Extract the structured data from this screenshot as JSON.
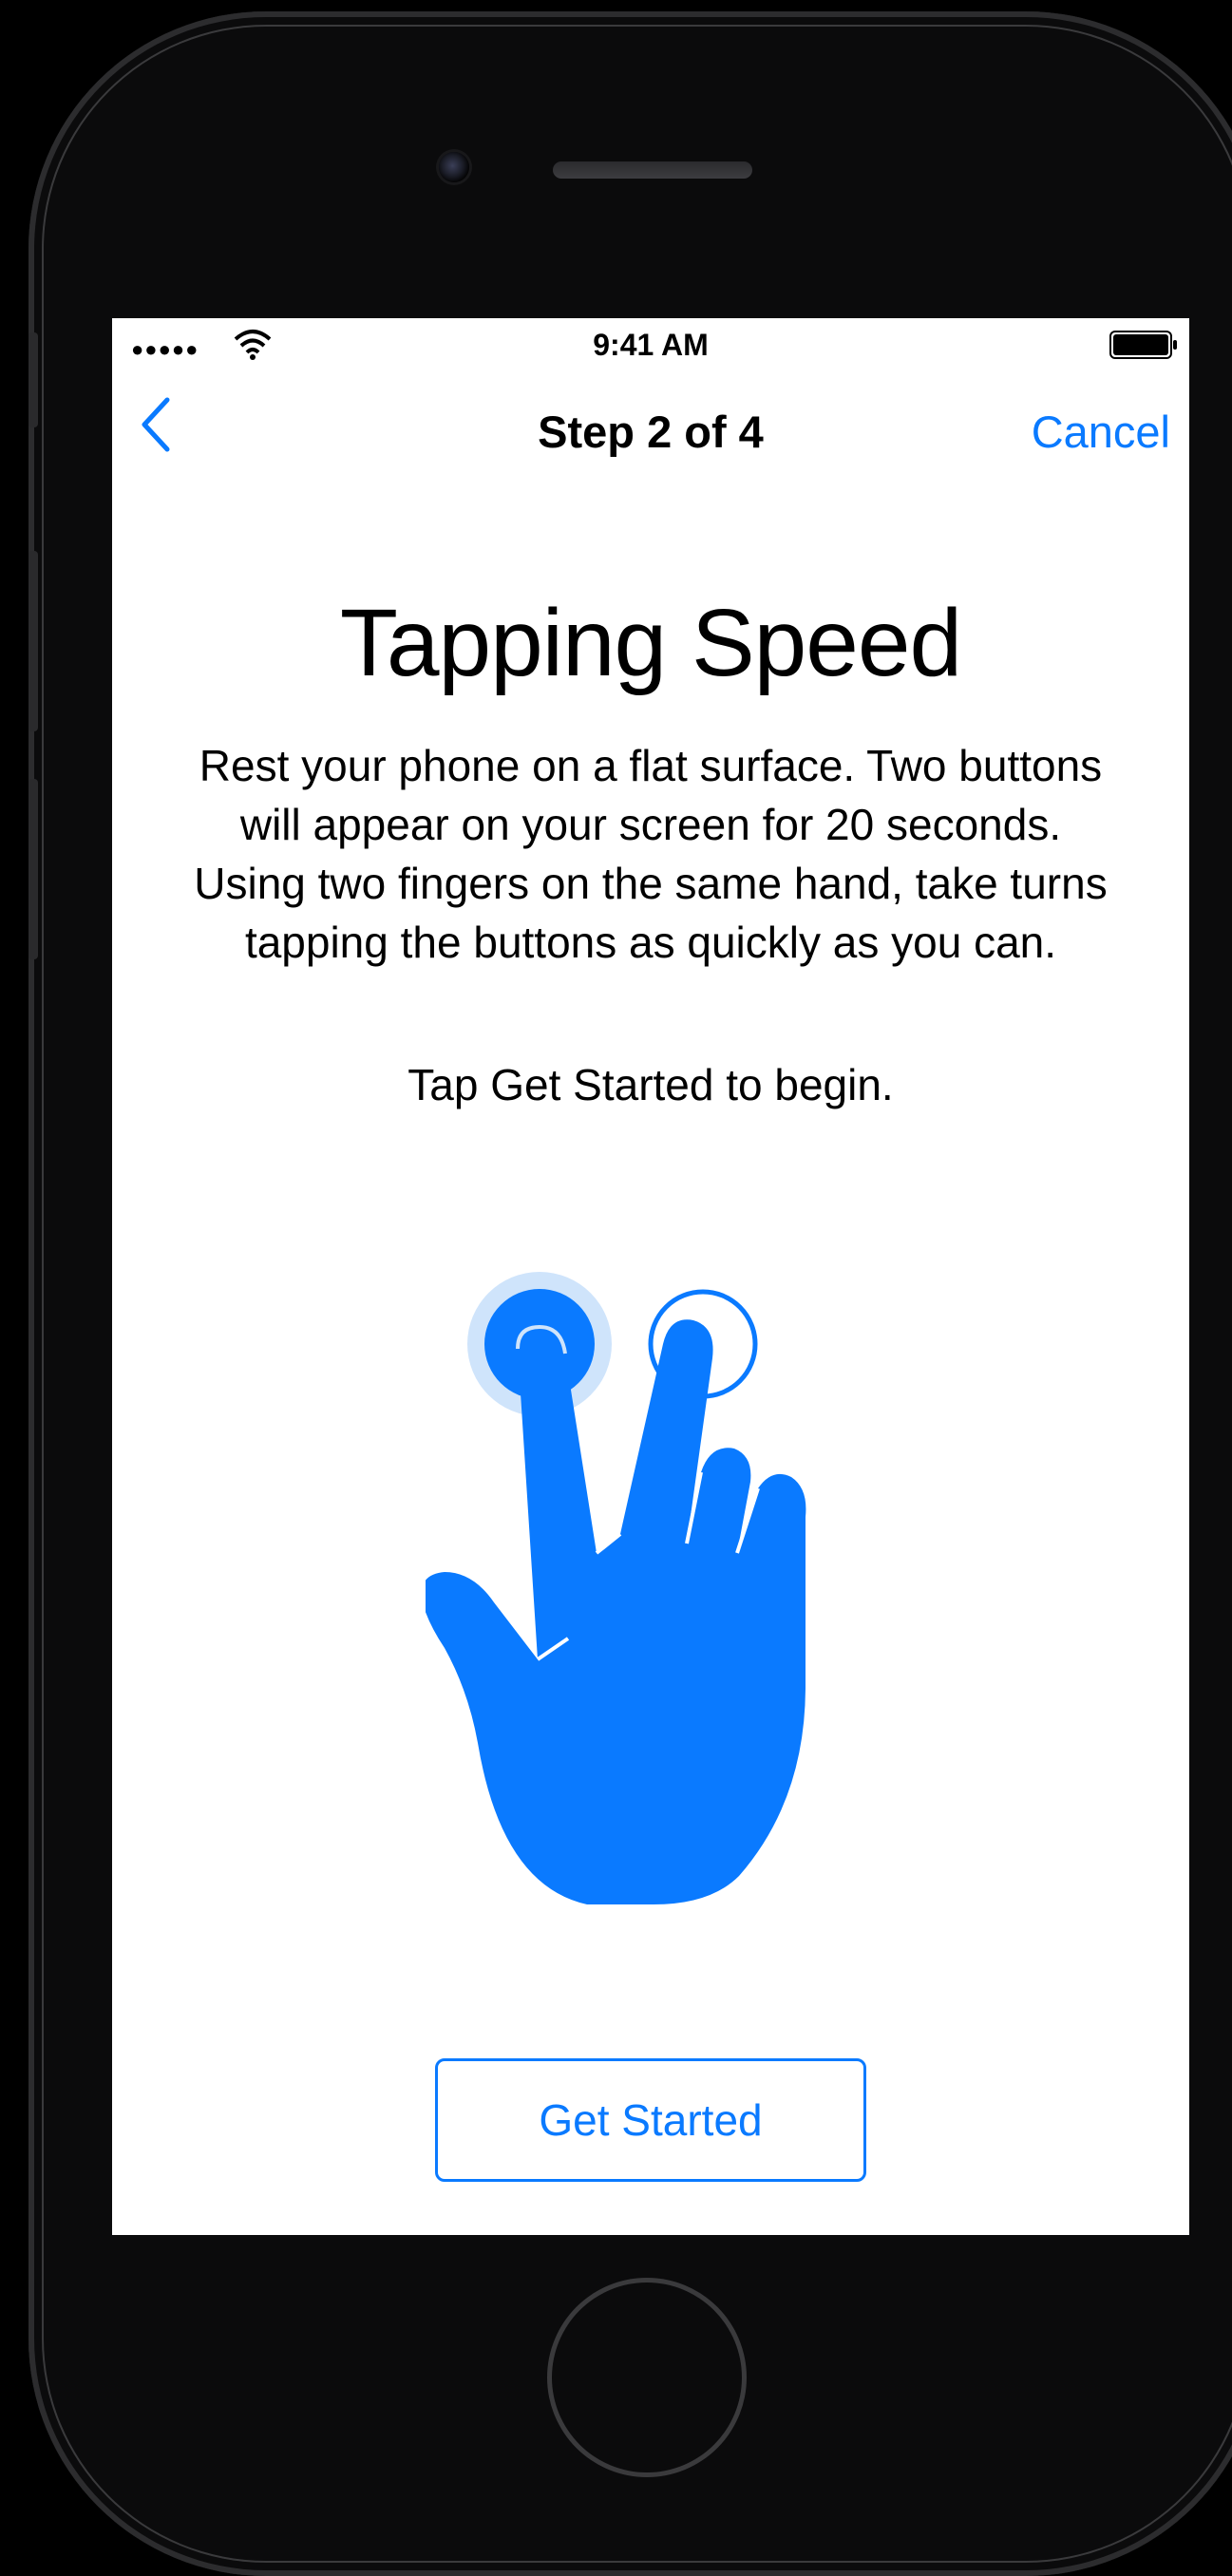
{
  "status_bar": {
    "signal": "●●●●●",
    "time": "9:41 AM",
    "wifi_icon": "wifi-icon",
    "battery_icon": "battery-full-icon"
  },
  "nav": {
    "back_icon": "chevron-left-icon",
    "title": "Step 2 of 4",
    "cancel_label": "Cancel"
  },
  "content": {
    "title": "Tapping Speed",
    "instructions": "Rest your phone on a flat surface. Two buttons will appear on your screen for 20 seconds. Using two fingers on the same hand, take turns tapping the buttons as quickly as you can.",
    "hint": "Tap Get Started to begin.",
    "illustration_icon": "two-finger-tap-hand-icon"
  },
  "actions": {
    "get_started_label": "Get Started"
  },
  "colors": {
    "accent": "#0a7aff",
    "accent_light": "#cfe4fb",
    "background": "#ffffff",
    "device": "#0b0b0c"
  }
}
